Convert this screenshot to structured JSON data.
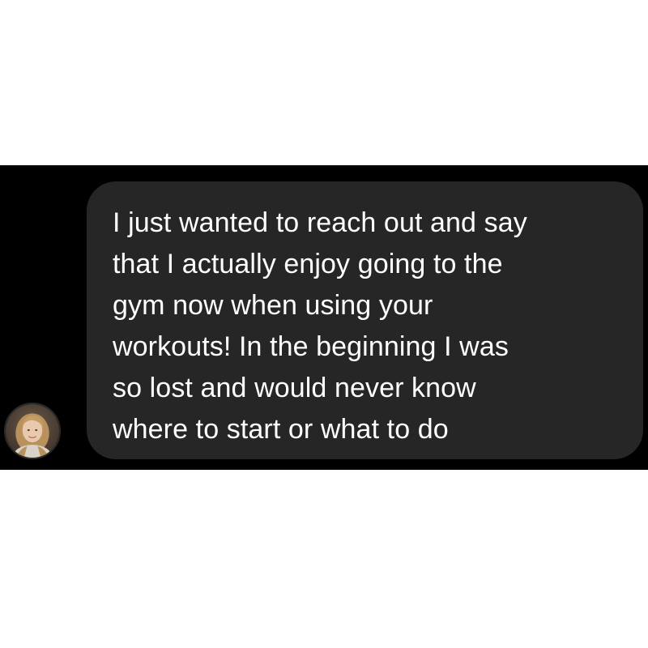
{
  "conversation": {
    "avatar_icon": "user-avatar-photo",
    "colors": {
      "background": "#000000",
      "bubble": "#262626",
      "text": "#ffffff"
    },
    "message": {
      "text": "I just wanted to reach out and say\nthat I actually enjoy going to the\ngym now when using your\nworkouts! In the beginning I was\nso lost and would never know\nwhere to start or what to do"
    }
  }
}
